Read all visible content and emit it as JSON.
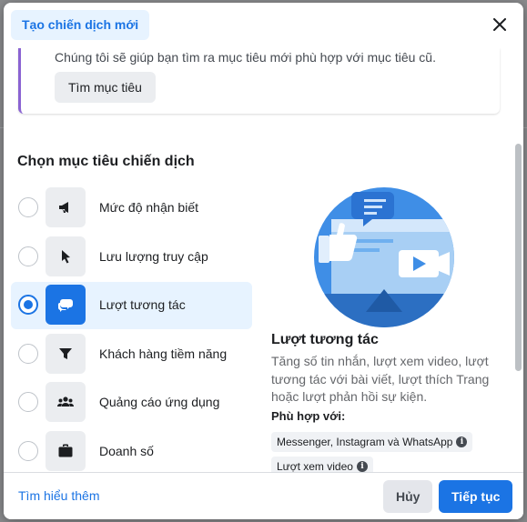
{
  "dialog": {
    "tab_label": "Tạo chiến dịch mới",
    "close_label": "Close"
  },
  "banner": {
    "text": "Chúng tôi sẽ giúp bạn tìm ra mục tiêu mới phù hợp với mục tiêu cũ.",
    "button_label": "Tìm mục tiêu"
  },
  "section_title": "Chọn mục tiêu chiến dịch",
  "objectives": [
    {
      "label": "Mức độ nhận biết",
      "icon": "megaphone-icon",
      "selected": false
    },
    {
      "label": "Lưu lượng truy cập",
      "icon": "cursor-icon",
      "selected": false
    },
    {
      "label": "Lượt tương tác",
      "icon": "chat-bubbles-icon",
      "selected": true
    },
    {
      "label": "Khách hàng tiềm năng",
      "icon": "funnel-icon",
      "selected": false
    },
    {
      "label": "Quảng cáo ứng dụng",
      "icon": "people-icon",
      "selected": false
    },
    {
      "label": "Doanh số",
      "icon": "briefcase-icon",
      "selected": false
    }
  ],
  "detail": {
    "title": "Lượt tương tác",
    "description": "Tăng số tin nhắn, lượt xem video, lượt tương tác với bài viết, lượt thích Trang hoặc lượt phản hồi sự kiện.",
    "fit_label": "Phù hợp với:",
    "chips": [
      "Messenger, Instagram và WhatsApp",
      "Lượt xem video"
    ]
  },
  "footer": {
    "learn_more": "Tìm hiểu thêm",
    "cancel": "Hủy",
    "continue": "Tiếp tục"
  },
  "colors": {
    "primary": "#1b74e4",
    "selected_bg": "#e7f3ff",
    "banner_accent": "#8a63d2"
  }
}
